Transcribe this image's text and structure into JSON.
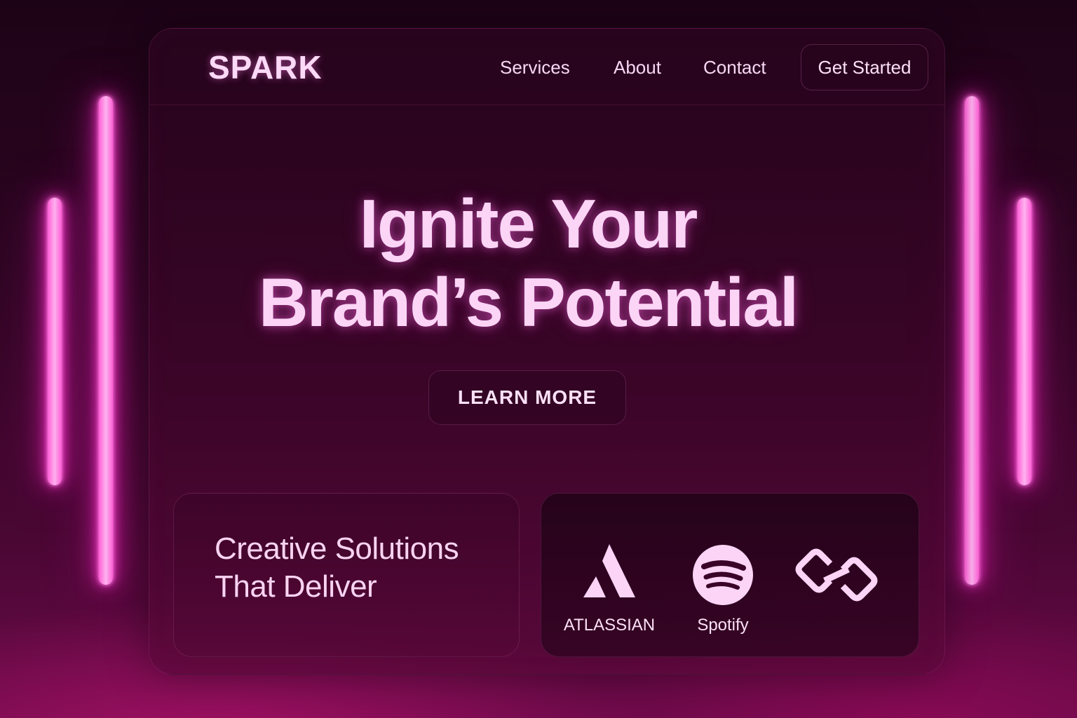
{
  "brand": {
    "name": "SPARK"
  },
  "nav": {
    "links": [
      {
        "label": "Services"
      },
      {
        "label": "About"
      },
      {
        "label": "Contact"
      }
    ],
    "cta_label": "Get Started"
  },
  "hero": {
    "title_lines": [
      "Ignite Your",
      "Brand’s Potential"
    ],
    "button_label": "LEARN MORE"
  },
  "features": {
    "heading_lines": [
      "Creative Solutions",
      "That Deliver"
    ]
  },
  "partners": [
    {
      "label": "ATLASSIAN",
      "icon": "atlassian-icon"
    },
    {
      "label": "Spotify",
      "icon": "spotify-icon"
    },
    {
      "label": "",
      "icon": "chain-link-icon"
    }
  ],
  "colors": {
    "neon_pink": "#ff5fd6",
    "text_pink": "#fbd4f6",
    "background_dark": "#1d0316",
    "background_magenta": "#6a0a48"
  }
}
